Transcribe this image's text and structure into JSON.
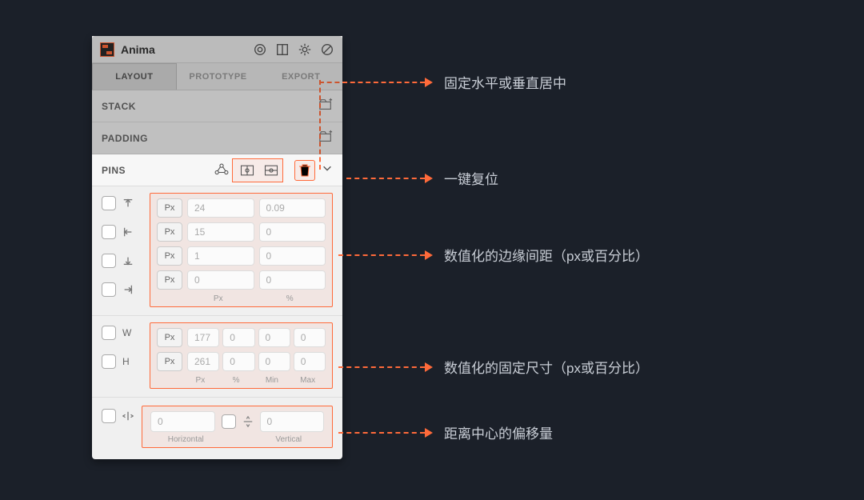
{
  "header": {
    "title": "Anima"
  },
  "tabs": [
    "LAYOUT",
    "PROTOTYPE",
    "EXPORT"
  ],
  "sections": {
    "stack": "STACK",
    "padding": "PADDING",
    "pins": "PINS"
  },
  "pins": {
    "pxLabel": "Px",
    "edges": [
      {
        "px": "24",
        "pct": "0.09"
      },
      {
        "px": "15",
        "pct": "0"
      },
      {
        "px": "1",
        "pct": "0"
      },
      {
        "px": "0",
        "pct": "0"
      }
    ],
    "edgeCaps": [
      "Px",
      "%"
    ],
    "wh": [
      {
        "label": "W",
        "px": "177",
        "pct": "0",
        "min": "0",
        "max": "0"
      },
      {
        "label": "H",
        "px": "261",
        "pct": "0",
        "min": "0",
        "max": "0"
      }
    ],
    "whCaps": [
      "Px",
      "%",
      "Min",
      "Max"
    ],
    "offset": {
      "h": "0",
      "v": "0",
      "hLabel": "Horizontal",
      "vLabel": "Vertical"
    }
  },
  "callouts": {
    "center": "固定水平或垂直居中",
    "reset": "一键复位",
    "edges": "数值化的边缘间距（px或百分比）",
    "size": "数值化的固定尺寸（px或百分比）",
    "offset": "距离中心的偏移量"
  }
}
